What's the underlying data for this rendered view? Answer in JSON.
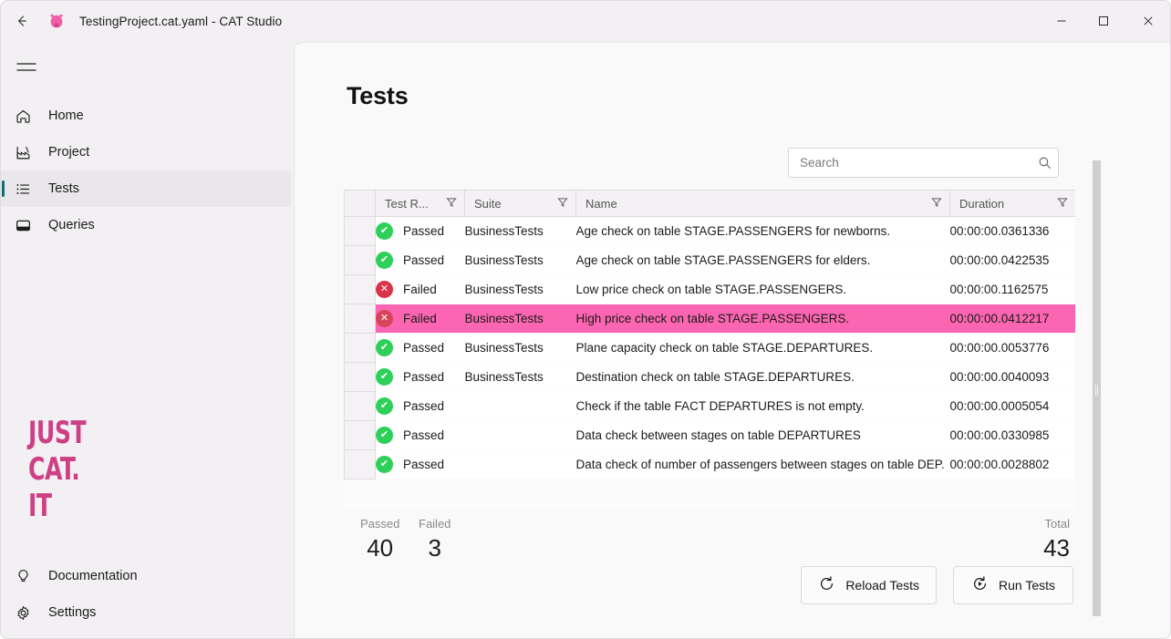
{
  "window": {
    "title": "TestingProject.cat.yaml - CAT Studio",
    "back_icon": "back-arrow-icon",
    "logo_icon": "cat-logo-icon",
    "minimize_label": "—",
    "maximize_label": "□",
    "close_label": "✕"
  },
  "sidebar": {
    "menu_icon": "hamburger-icon",
    "brand": {
      "line1": "JUST",
      "line2": "CAT.",
      "line3": "IT",
      "color": "#cf3f84"
    },
    "items": [
      {
        "label": "Home",
        "icon": "home-icon",
        "selected": false
      },
      {
        "label": "Project",
        "icon": "factory-icon",
        "selected": false
      },
      {
        "label": "Tests",
        "icon": "list-icon",
        "selected": true
      },
      {
        "label": "Queries",
        "icon": "table-icon",
        "selected": false
      }
    ],
    "bottom_items": [
      {
        "label": "Documentation",
        "icon": "bulb-icon"
      },
      {
        "label": "Settings",
        "icon": "gear-icon"
      }
    ],
    "selection_color": "#0f6f78"
  },
  "main": {
    "title": "Tests",
    "search": {
      "value": "",
      "placeholder": "Search",
      "icon": "search-icon"
    },
    "table": {
      "columns": [
        {
          "key": "gutter",
          "label": "",
          "filter": false
        },
        {
          "key": "result",
          "label": "Test R...",
          "filter": true
        },
        {
          "key": "suite",
          "label": "Suite",
          "filter": true
        },
        {
          "key": "name",
          "label": "Name",
          "filter": true
        },
        {
          "key": "duration",
          "label": "Duration",
          "filter": true
        }
      ],
      "rows": [
        {
          "result": "Passed",
          "status": "pass",
          "suite": "BusinessTests",
          "name": "Age check on table STAGE.PASSENGERS for newborns.",
          "duration": "00:00:00.0361336",
          "selected": false
        },
        {
          "result": "Passed",
          "status": "pass",
          "suite": "BusinessTests",
          "name": "Age check on table STAGE.PASSENGERS for elders.",
          "duration": "00:00:00.0422535",
          "selected": false
        },
        {
          "result": "Failed",
          "status": "fail",
          "suite": "BusinessTests",
          "name": "Low price check on table STAGE.PASSENGERS.",
          "duration": "00:00:00.1162575",
          "selected": false
        },
        {
          "result": "Failed",
          "status": "fail",
          "suite": "BusinessTests",
          "name": "High price check on table STAGE.PASSENGERS.",
          "duration": "00:00:00.0412217",
          "selected": true
        },
        {
          "result": "Passed",
          "status": "pass",
          "suite": "BusinessTests",
          "name": "Plane capacity check on table STAGE.DEPARTURES.",
          "duration": "00:00:00.0053776",
          "selected": false
        },
        {
          "result": "Passed",
          "status": "pass",
          "suite": "BusinessTests",
          "name": "Destination check on table STAGE.DEPARTURES.",
          "duration": "00:00:00.0040093",
          "selected": false
        },
        {
          "result": "Passed",
          "status": "pass",
          "suite": "",
          "name": "Check if the table FACT DEPARTURES is not empty.",
          "duration": "00:00:00.0005054",
          "selected": false
        },
        {
          "result": "Passed",
          "status": "pass",
          "suite": "",
          "name": "Data check between stages on table DEPARTURES",
          "duration": "00:00:00.0330985",
          "selected": false
        },
        {
          "result": "Passed",
          "status": "pass",
          "suite": "",
          "name": "Data check of number of passengers between stages on table DEP.",
          "duration": "00:00:00.0028802",
          "selected": false
        }
      ],
      "pass_glyph": "✔",
      "fail_glyph": "✕",
      "selected_row_color": "#fb65b1"
    },
    "summary": {
      "passed_label": "Passed",
      "passed_value": "40",
      "failed_label": "Failed",
      "failed_value": "3",
      "total_label": "Total",
      "total_value": "43"
    },
    "buttons": {
      "reload": {
        "label": "Reload Tests",
        "icon": "reload-icon"
      },
      "run": {
        "label": "Run Tests",
        "icon": "play-circle-icon"
      }
    }
  }
}
